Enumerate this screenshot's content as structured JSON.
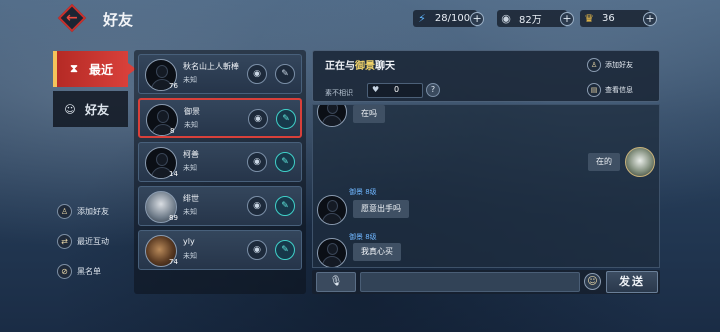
{
  "header": {
    "title": "好友",
    "resources": [
      {
        "icon": "lightning-icon",
        "value": "28/100"
      },
      {
        "icon": "coin-icon",
        "value": "82万"
      },
      {
        "icon": "crown-icon",
        "value": "36"
      }
    ]
  },
  "sidebar": {
    "tabs": [
      {
        "label": "最近",
        "icon": "hourglass-icon"
      },
      {
        "label": "好友",
        "icon": "friends-icon"
      }
    ],
    "actions": [
      {
        "label": "添加好友",
        "icon": "add-friend-icon"
      },
      {
        "label": "最近互动",
        "icon": "interaction-icon"
      },
      {
        "label": "黑名单",
        "icon": "blacklist-icon"
      }
    ]
  },
  "friends": [
    {
      "name": "秋名山上人斬棒",
      "status": "未知",
      "level": "76"
    },
    {
      "name": "御景",
      "status": "未知",
      "level": "8"
    },
    {
      "name": "柯善",
      "status": "未知",
      "level": "14"
    },
    {
      "name": "绯世",
      "status": "未知",
      "level": "89"
    },
    {
      "name": "yly",
      "status": "未知",
      "level": "74"
    }
  ],
  "chat": {
    "title_prefix": "正在与",
    "partner": "御景",
    "title_suffix": "聊天",
    "intimacy_label": "素不相识",
    "intimacy_value": "0",
    "help": "?",
    "add_friend_label": "添加好友",
    "view_info_label": "查看信息",
    "messages": [
      {
        "sender": "",
        "text": "在吗"
      },
      {
        "sender": "",
        "text": "在的"
      },
      {
        "sender": "御景 8级",
        "text": "愿意出手吗"
      },
      {
        "sender": "御景 8级",
        "text": "我真心买"
      }
    ],
    "send_label": "发送"
  }
}
